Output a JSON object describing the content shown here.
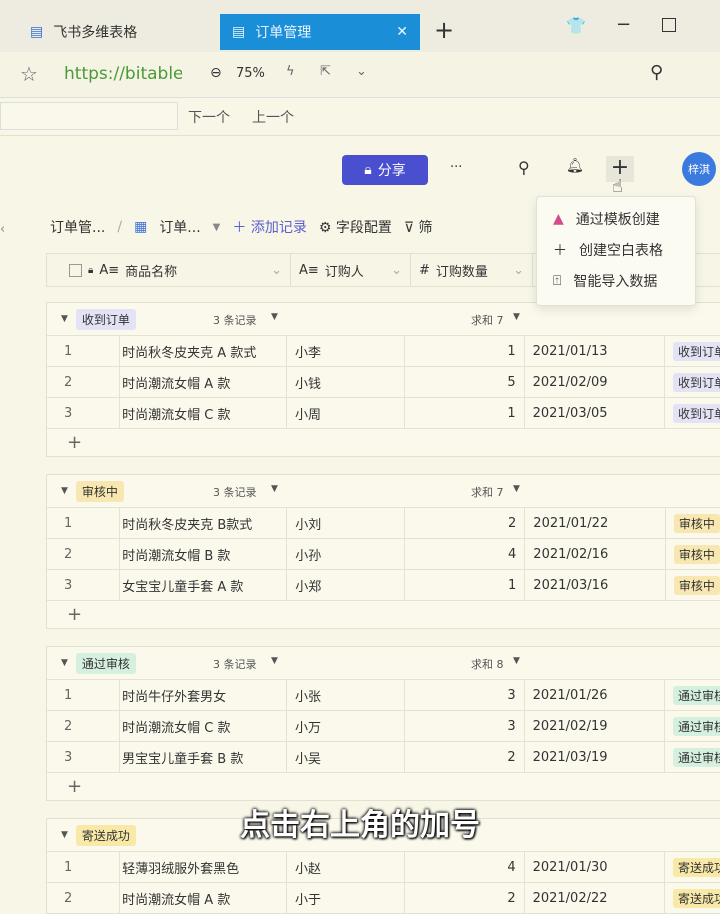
{
  "browser": {
    "tabs": [
      {
        "label": "飞书多维表格"
      },
      {
        "label": "订单管理"
      }
    ],
    "url": "https://bitable",
    "zoom": "75%",
    "find_next": "下一个",
    "find_prev": "上一个"
  },
  "header": {
    "share": "分享",
    "more": "···",
    "avatar": "梓淇"
  },
  "toolbar": {
    "breadcrumb_base": "订单管...",
    "breadcrumb_sep": "/",
    "table": "订单...",
    "add_record": "添加记录",
    "field_config": "字段配置",
    "filter": "筛"
  },
  "columns": [
    "商品名称",
    "订购人",
    "订购数量"
  ],
  "menu": {
    "items": [
      "通过模板创建",
      "创建空白表格",
      "智能导入数据"
    ]
  },
  "groups": [
    {
      "name": "收到订单",
      "count": "3 条记录",
      "sum": "求和 7",
      "tag_color": "#e3e3f5",
      "rows": [
        [
          "1",
          "时尚秋冬皮夹克 A 款式",
          "小李",
          "1",
          "2021/01/13",
          "收到订单"
        ],
        [
          "2",
          "时尚潮流女帽 A 款",
          "小钱",
          "5",
          "2021/02/09",
          "收到订单"
        ],
        [
          "3",
          "时尚潮流女帽 C 款",
          "小周",
          "1",
          "2021/03/05",
          "收到订单"
        ]
      ]
    },
    {
      "name": "审核中",
      "count": "3 条记录",
      "sum": "求和 7",
      "tag_color": "#f8e7b0",
      "rows": [
        [
          "1",
          "时尚秋冬皮夹克 B款式",
          "小刘",
          "2",
          "2021/01/22",
          "审核中"
        ],
        [
          "2",
          "时尚潮流女帽 B 款",
          "小孙",
          "4",
          "2021/02/16",
          "审核中"
        ],
        [
          "3",
          "女宝宝儿童手套 A 款",
          "小郑",
          "1",
          "2021/03/16",
          "审核中"
        ]
      ]
    },
    {
      "name": "通过审核",
      "count": "3 条记录",
      "sum": "求和 8",
      "tag_color": "#d6f0df",
      "rows": [
        [
          "1",
          "时尚牛仔外套男女",
          "小张",
          "3",
          "2021/01/26",
          "通过审核"
        ],
        [
          "2",
          "时尚潮流女帽 C 款",
          "小万",
          "3",
          "2021/02/19",
          "通过审核"
        ],
        [
          "3",
          "男宝宝儿童手套 B 款",
          "小吴",
          "2",
          "2021/03/19",
          "通过审核"
        ]
      ]
    },
    {
      "name": "寄送成功",
      "count": "",
      "sum": "",
      "tag_color": "#f8e9a8",
      "rows": [
        [
          "1",
          "轻薄羽绒服外套黑色",
          "小赵",
          "4",
          "2021/01/30",
          "寄送成功"
        ],
        [
          "2",
          "时尚潮流女帽 A 款",
          "小于",
          "2",
          "2021/02/22",
          "寄送成功"
        ]
      ]
    }
  ],
  "subtitle": "点击右上角的加号"
}
